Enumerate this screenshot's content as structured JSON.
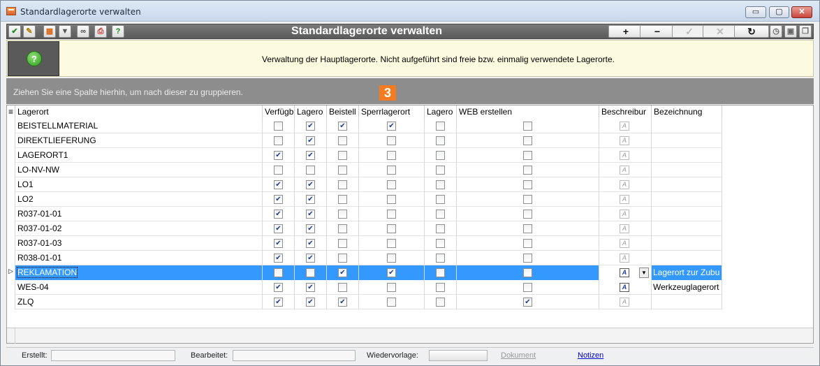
{
  "window": {
    "title": "Standardlagerorte verwalten",
    "min_label": "▭",
    "max_label": "▢",
    "close_label": "✕"
  },
  "toolbar": {
    "title": "Standardlagerorte verwalten",
    "add_label": "+",
    "remove_label": "−",
    "confirm_label": "✓",
    "cancel_label": "✕",
    "refresh_label": "↻"
  },
  "info": {
    "text": "Verwaltung der Hauptlagerorte. Nicht aufgeführt sind freie bzw. einmalig verwendete Lagerorte.",
    "icon_label": "?"
  },
  "groupbar": {
    "text": "Ziehen Sie eine Spalte hierhin, um nach dieser zu gruppieren.",
    "badge": "3"
  },
  "columns": [
    "Lagerort",
    "Verfügb",
    "Lagero",
    "Beistell",
    "Sperrlagerort",
    "Lagero",
    "WEB erstellen",
    "Beschreibur",
    "Bezeichnung"
  ],
  "rows": [
    {
      "lagerort": "BEISTELLMATERIAL",
      "verfueg": false,
      "lagero": true,
      "beistell": true,
      "sperr": true,
      "lagero2": false,
      "web": false,
      "desc_active": false,
      "bezeichnung": ""
    },
    {
      "lagerort": "DIREKTLIEFERUNG",
      "verfueg": false,
      "lagero": true,
      "beistell": false,
      "sperr": false,
      "lagero2": false,
      "web": false,
      "desc_active": false,
      "bezeichnung": ""
    },
    {
      "lagerort": "LAGERORT1",
      "verfueg": true,
      "lagero": true,
      "beistell": false,
      "sperr": false,
      "lagero2": false,
      "web": false,
      "desc_active": false,
      "bezeichnung": ""
    },
    {
      "lagerort": "LO-NV-NW",
      "verfueg": false,
      "lagero": false,
      "beistell": false,
      "sperr": false,
      "lagero2": false,
      "web": false,
      "desc_active": false,
      "bezeichnung": ""
    },
    {
      "lagerort": "LO1",
      "verfueg": true,
      "lagero": true,
      "beistell": false,
      "sperr": false,
      "lagero2": false,
      "web": false,
      "desc_active": false,
      "bezeichnung": ""
    },
    {
      "lagerort": "LO2",
      "verfueg": true,
      "lagero": true,
      "beistell": false,
      "sperr": false,
      "lagero2": false,
      "web": false,
      "desc_active": false,
      "bezeichnung": ""
    },
    {
      "lagerort": "R037-01-01",
      "verfueg": true,
      "lagero": true,
      "beistell": false,
      "sperr": false,
      "lagero2": false,
      "web": false,
      "desc_active": false,
      "bezeichnung": ""
    },
    {
      "lagerort": "R037-01-02",
      "verfueg": true,
      "lagero": true,
      "beistell": false,
      "sperr": false,
      "lagero2": false,
      "web": false,
      "desc_active": false,
      "bezeichnung": ""
    },
    {
      "lagerort": "R037-01-03",
      "verfueg": true,
      "lagero": true,
      "beistell": false,
      "sperr": false,
      "lagero2": false,
      "web": false,
      "desc_active": false,
      "bezeichnung": ""
    },
    {
      "lagerort": "R038-01-01",
      "verfueg": true,
      "lagero": true,
      "beistell": false,
      "sperr": false,
      "lagero2": false,
      "web": false,
      "desc_active": false,
      "bezeichnung": ""
    },
    {
      "lagerort": "REKLAMATION",
      "verfueg": false,
      "lagero": false,
      "beistell": true,
      "sperr": true,
      "lagero2": false,
      "web": false,
      "desc_active": true,
      "bezeichnung": "Lagerort zur Zubu",
      "selected": true
    },
    {
      "lagerort": "WES-04",
      "verfueg": true,
      "lagero": true,
      "beistell": false,
      "sperr": false,
      "lagero2": false,
      "web": false,
      "desc_active": true,
      "bezeichnung": "Werkzeuglagerort"
    },
    {
      "lagerort": "ZLQ",
      "verfueg": true,
      "lagero": true,
      "beistell": true,
      "sperr": false,
      "lagero2": false,
      "web": true,
      "desc_active": false,
      "bezeichnung": ""
    }
  ],
  "status": {
    "erstellt_label": "Erstellt:",
    "bearbeitet_label": "Bearbeitet:",
    "wiedervorlage_label": "Wiedervorlage:",
    "dokument_label": "Dokument",
    "notizen_label": "Notizen"
  },
  "colors": {
    "accent": "#3399ff",
    "badge": "#f47b20",
    "groupbar": "#8d8d8d",
    "info_bg": "#fcfbdf"
  }
}
